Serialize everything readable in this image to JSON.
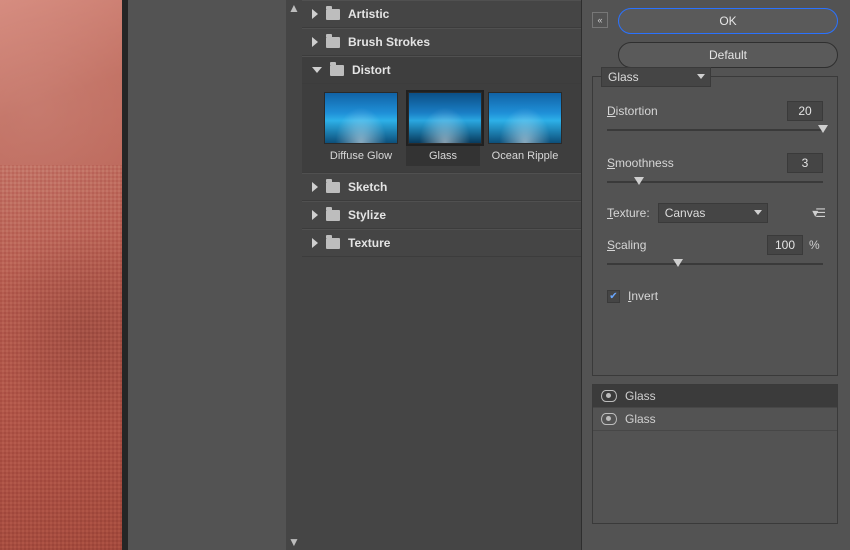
{
  "buttons": {
    "ok": "OK",
    "default": "Default"
  },
  "gallery": {
    "categories": [
      {
        "name": "Artistic",
        "expanded": false
      },
      {
        "name": "Brush Strokes",
        "expanded": false
      },
      {
        "name": "Distort",
        "expanded": true
      },
      {
        "name": "Sketch",
        "expanded": false
      },
      {
        "name": "Stylize",
        "expanded": false
      },
      {
        "name": "Texture",
        "expanded": false
      }
    ],
    "distort_thumbs": [
      {
        "label": "Diffuse Glow",
        "selected": false
      },
      {
        "label": "Glass",
        "selected": true
      },
      {
        "label": "Ocean Ripple",
        "selected": false
      }
    ]
  },
  "filter_select": "Glass",
  "params": {
    "distortion": {
      "label_pre": "D",
      "label_rest": "istortion",
      "value": "20",
      "pos": 100
    },
    "smoothness": {
      "label_pre": "S",
      "label_rest": "moothness",
      "value": "3",
      "pos": 15
    },
    "texture": {
      "label_pre": "T",
      "label_rest": "exture:",
      "value": "Canvas"
    },
    "scaling": {
      "label_pre": "S",
      "label_rest": "caling",
      "value": "100",
      "unit": "%",
      "pos": 33
    },
    "invert": {
      "label_pre": "I",
      "label_rest": "nvert",
      "checked": true
    }
  },
  "layers": [
    {
      "name": "Glass",
      "visible": true,
      "selected": true
    },
    {
      "name": "Glass",
      "visible": true,
      "selected": false
    }
  ]
}
